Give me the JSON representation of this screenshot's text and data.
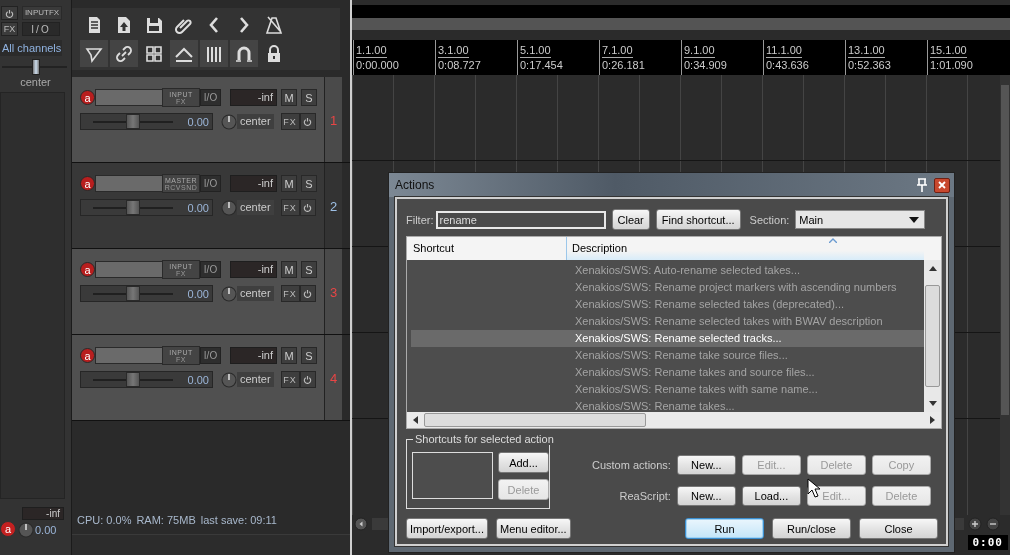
{
  "master": {
    "fx_label": "INPUTFX",
    "fx_button": "FX",
    "io_button": "I/O",
    "channels": "All channels",
    "pan": "center",
    "level": 0.5,
    "arm": "a",
    "meter": "-inf",
    "volume": "0.00"
  },
  "toolbar": [
    {
      "kind": "document",
      "on": false
    },
    {
      "kind": "upload",
      "on": false
    },
    {
      "kind": "save",
      "on": false
    },
    {
      "kind": "paperclip",
      "on": false
    },
    {
      "kind": "chevron-left",
      "on": false
    },
    {
      "kind": "chevron-right",
      "on": false
    },
    {
      "kind": "metronome",
      "on": false
    },
    {
      "kind": "pointer",
      "on": true
    },
    {
      "kind": "link",
      "on": true
    },
    {
      "kind": "grid",
      "on": false
    },
    {
      "kind": "ramp",
      "on": true
    },
    {
      "kind": "bars",
      "on": true
    },
    {
      "kind": "magnet",
      "on": true
    },
    {
      "kind": "lock",
      "on": false
    }
  ],
  "tracks": [
    {
      "number": "1",
      "selected": true,
      "arm": "a",
      "fx_label": [
        "INPUT",
        "FX"
      ],
      "io": "I/O",
      "meter": "-inf",
      "mute": "M",
      "solo": "S",
      "level": 0.5,
      "volume": "0.00",
      "pan": "center",
      "fx": "FX"
    },
    {
      "number": "2",
      "selected": false,
      "arm": "a",
      "fx_label": [
        "MASTER",
        "RCVSND"
      ],
      "io": "I/O",
      "meter": "-inf",
      "mute": "M",
      "solo": "S",
      "level": 0.5,
      "volume": "0.00",
      "pan": "center",
      "fx": "FX"
    },
    {
      "number": "3",
      "selected": true,
      "arm": "a",
      "fx_label": [
        "INPUT",
        "FX"
      ],
      "io": "I/O",
      "meter": "-inf",
      "mute": "M",
      "solo": "S",
      "level": 0.5,
      "volume": "0.00",
      "pan": "center",
      "fx": "FX"
    },
    {
      "number": "4",
      "selected": true,
      "arm": "a",
      "fx_label": [
        "INPUT",
        "FX"
      ],
      "io": "I/O",
      "meter": "-inf",
      "mute": "M",
      "solo": "S",
      "level": 0.5,
      "volume": "0.00",
      "pan": "center",
      "fx": "FX"
    }
  ],
  "status_bar": [
    "CPU: 0.0%",
    "RAM: 75MB",
    "last save: 09:11"
  ],
  "ruler": [
    {
      "bar": "1.1.00",
      "time": "0:00.000"
    },
    {
      "bar": "3.1.00",
      "time": "0:08.727"
    },
    {
      "bar": "5.1.00",
      "time": "0:17.454"
    },
    {
      "bar": "7.1.00",
      "time": "0:26.181"
    },
    {
      "bar": "9.1.00",
      "time": "0:34.909"
    },
    {
      "bar": "11.1.00",
      "time": "0:43.636"
    },
    {
      "bar": "13.1.00",
      "time": "0:52.363"
    },
    {
      "bar": "15.1.00",
      "time": "1:01.090"
    }
  ],
  "clock": "0:00",
  "dialog": {
    "title": "Actions",
    "filter_label": "Filter:",
    "filter": "rename",
    "clear": "Clear",
    "find": "Find shortcut...",
    "section_label": "Section:",
    "section": "Main",
    "columns": [
      "Shortcut",
      "Description"
    ],
    "rows": [
      {
        "description": "Xenakios/SWS: Auto-rename selected takes...",
        "selected": false
      },
      {
        "description": "Xenakios/SWS: Rename project markers with ascending numbers",
        "selected": false
      },
      {
        "description": "Xenakios/SWS: Rename selected takes (deprecated)...",
        "selected": false
      },
      {
        "description": "Xenakios/SWS: Rename selected takes with BWAV description",
        "selected": false
      },
      {
        "description": "Xenakios/SWS: Rename selected tracks...",
        "selected": true
      },
      {
        "description": "Xenakios/SWS: Rename take source files...",
        "selected": false
      },
      {
        "description": "Xenakios/SWS: Rename takes and source files...",
        "selected": false
      },
      {
        "description": "Xenakios/SWS: Rename takes with same name...",
        "selected": false
      },
      {
        "description": "Xenakios/SWS: Rename takes...",
        "selected": false
      }
    ],
    "shortcuts_group": "Shortcuts for selected action",
    "add": {
      "label": "Add...",
      "disabled": false
    },
    "delete": {
      "label": "Delete",
      "disabled": true
    },
    "custom_label": "Custom actions:",
    "custom_buttons": [
      {
        "label": "New...",
        "disabled": false
      },
      {
        "label": "Edit...",
        "disabled": true
      },
      {
        "label": "Delete",
        "disabled": true
      },
      {
        "label": "Copy",
        "disabled": true
      }
    ],
    "script_label": "ReaScript:",
    "script_buttons": [
      {
        "label": "New...",
        "disabled": false
      },
      {
        "label": "Load...",
        "disabled": false
      },
      {
        "label": "Edit...",
        "disabled": true
      },
      {
        "label": "Delete",
        "disabled": true
      }
    ],
    "left_buttons": [
      {
        "label": "Import/export...",
        "default": false
      },
      {
        "label": "Menu editor...",
        "default": false
      }
    ],
    "right_buttons": [
      {
        "label": "Run",
        "default": true
      },
      {
        "label": "Run/close",
        "default": false
      },
      {
        "label": "Close",
        "default": false
      }
    ]
  }
}
